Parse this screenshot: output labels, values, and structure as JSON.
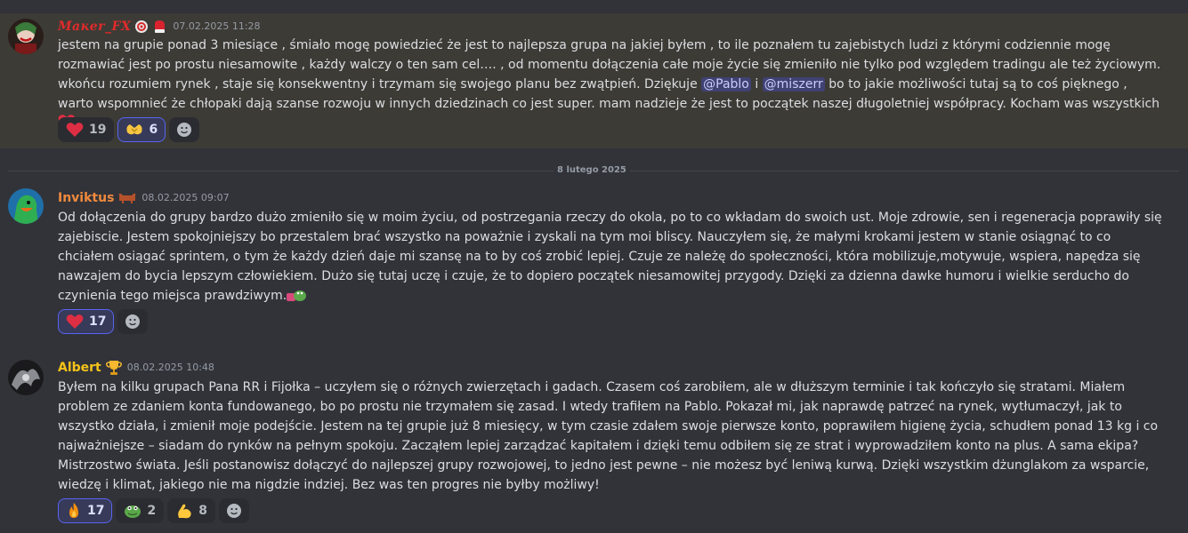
{
  "date_divider": "8 lutego 2025",
  "messages": [
    {
      "author": "Maĸer_FX",
      "timestamp": "07.02.2025 11:28",
      "text_before_mentions": "jestem na grupie ponad 3 miesiące , śmiało mogę powiedzieć że jest to najlepsza grupa na jakiej byłem , to ile poznałem tu zajebistych ludzi z którymi codziennie mogę rozmawiać jest po prostu niesamowite , każdy walczy o ten sam cel…. , od momentu dołączenia całe moje życie się zmieniło nie tylko pod względem tradingu ale też życiowym. wkońcu rozumiem rynek , staje się konsekwentny i trzymam się swojego planu bez zwątpień. Dziękuje",
      "mention_1": "@Pablo",
      "text_between": "i",
      "mention_2": "@miszerr",
      "text_after_mentions": "bo to jakie możliwości tutaj są to coś pięknego , warto wspomnieć że chłopaki dają szanse rozwoju w innych dziedzinach co jest super. mam nadzieje że jest to początek naszej długoletniej współpracy. Kocham was wszystkich",
      "reactions": [
        {
          "icon": "heart-icon",
          "count": "19"
        },
        {
          "icon": "heart-hands-icon",
          "count": "6"
        }
      ]
    },
    {
      "author": "Inviktus",
      "timestamp": "08.02.2025 09:07",
      "text": "Od dołączenia do grupy bardzo dużo zmieniło się w moim życiu, od postrzegania rzeczy do okola, po to co wkładam do swoich ust. Moje zdrowie, sen i regeneracja poprawiły się zajebiscie. Jestem spokojniejszy bo przestalem brać wszystko na poważnie i zyskali na tym moi bliscy. Nauczyłem się, że małymi krokami jestem w stanie osiągnąć to co chciałem osiągać sprintem, o tym że każdy dzień daje mi szansę na to by coś zrobić lepiej. Czuje ze należę do społeczności, która mobilizuje,motywuje, wspiera, napędza się nawzajem do bycia lepszym człowiekiem. Dużo się tutaj uczę i czuje, że to dopiero początek niesamowitej przygody. Dzięki za dzienna dawke humoru i wielkie serducho do czynienia tego miejsca prawdziwym.",
      "reactions": [
        {
          "icon": "heart-icon",
          "count": "17"
        }
      ]
    },
    {
      "author": "Albert",
      "timestamp": "08.02.2025 10:48",
      "text": "Byłem na kilku grupach Pana RR i Fijołka – uczyłem się o różnych zwierzętach i gadach. Czasem coś zarobiłem, ale w dłuższym terminie i tak kończyło się stratami. Miałem problem ze zdaniem konta fundowanego, bo po prostu nie trzymałem się zasad. I wtedy trafiłem na Pablo. Pokazał mi, jak naprawdę patrzeć na rynek, wytłumaczył, jak to wszystko działa, i zmienił moje podejście. Jestem na tej grupie już 8 miesięcy, w tym czasie zdałem swoje pierwsze konto, poprawiłem higienę życia, schudłem ponad 13 kg i co najważniejsze – siadam do rynków na pełnym spokoju. Zacząłem lepiej zarządzać kapitałem i dzięki temu odbiłem się ze strat i wyprowadziłem konto na plus. A sama ekipa? Mistrzostwo świata. Jeśli postanowisz dołączyć do najlepszej grupy rozwojowej, to jedno jest pewne – nie możesz być leniwą kurwą. Dzięki wszystkim dżunglakom za wsparcie, wiedzę i klimat, jakiego nie ma nigdzie indziej. Bez was ten progres nie byłby możliwy!",
      "reactions": [
        {
          "icon": "fire-icon",
          "count": "17"
        },
        {
          "icon": "frog-icon",
          "count": "2"
        },
        {
          "icon": "flexed-biceps-icon",
          "count": "8"
        }
      ]
    }
  ],
  "colors": {
    "background": "#323339",
    "highlight": "#3d3b36",
    "mention_bg": "#3f4273",
    "reaction_bg": "#2b2c31",
    "reaction_mine_border": "#5865f2"
  }
}
